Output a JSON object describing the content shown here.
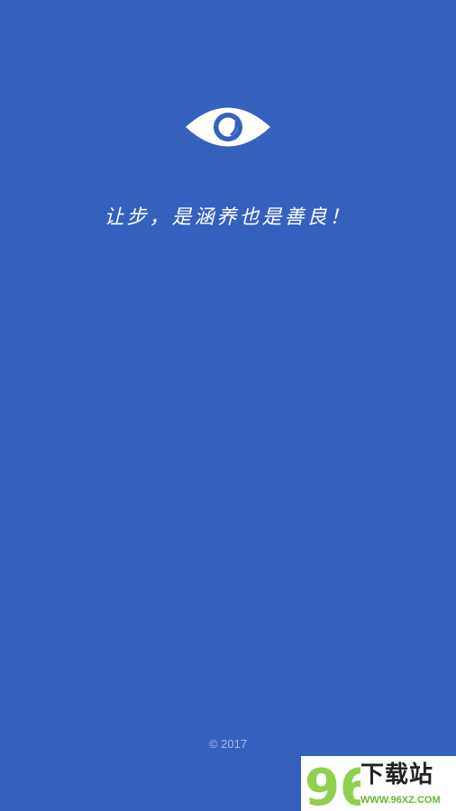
{
  "splash": {
    "logo_icon": "eye-icon",
    "slogan": "让步，是涵养也是善良！",
    "copyright": "© 2017"
  },
  "watermark": {
    "logo_text": "96",
    "title": "下载站",
    "url": "WWW.96XZ.COM"
  },
  "colors": {
    "background": "#3461bd",
    "foreground": "#ffffff",
    "watermark_green": "#6bb52e"
  }
}
